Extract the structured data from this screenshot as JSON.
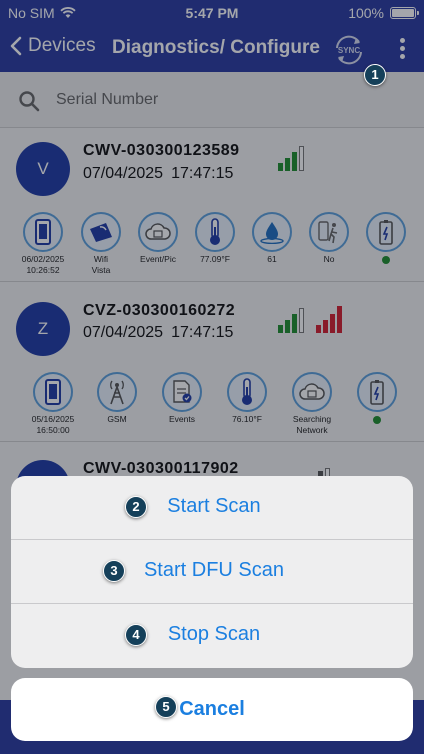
{
  "status_bar": {
    "carrier": "No SIM",
    "time": "5:47 PM",
    "battery": "100%"
  },
  "nav": {
    "back_label": "Devices",
    "title": "Diagnostics/ Configure",
    "sync_label": "SYNC"
  },
  "search": {
    "placeholder": "Serial Number"
  },
  "devices": [
    {
      "initial": "V",
      "serial": "CWV-030300123589",
      "date": "07/04/2025",
      "time": "17:47:15",
      "signal_bars": [
        {
          "level": 3,
          "color": "#1f8f2e"
        }
      ],
      "chips": [
        {
          "icon": "device-icon",
          "label": "06/02/2025\n10:26:52"
        },
        {
          "icon": "wifi-icon",
          "label": "Wifi\nVista"
        },
        {
          "icon": "cloud-image-icon",
          "label": "Event/Pic"
        },
        {
          "icon": "thermometer-icon",
          "label": "77.09°F"
        },
        {
          "icon": "water-drop-icon",
          "label": "61"
        },
        {
          "icon": "motion-icon",
          "label": "No"
        },
        {
          "icon": "battery-icon",
          "label": "",
          "dot": true
        }
      ]
    },
    {
      "initial": "Z",
      "serial": "CVZ-030300160272",
      "date": "07/04/2025",
      "time": "17:47:15",
      "signal_bars": [
        {
          "level": 3,
          "color": "#1f8f2e"
        },
        {
          "level": 4,
          "color": "#d32030"
        }
      ],
      "chips": [
        {
          "icon": "device-icon",
          "label": "05/16/2025\n16:50:00"
        },
        {
          "icon": "cell-tower-icon",
          "label": "GSM"
        },
        {
          "icon": "events-icon",
          "label": "Events"
        },
        {
          "icon": "thermometer-icon",
          "label": "76.10°F"
        },
        {
          "icon": "cloud-image-icon",
          "label": "Searching\nNetwork"
        },
        {
          "icon": "battery-icon",
          "label": "",
          "dot": true
        }
      ]
    },
    {
      "initial": "",
      "serial": "CWV-030300117902"
    }
  ],
  "action_sheet": {
    "options": [
      {
        "badge": "2",
        "label": "Start Scan"
      },
      {
        "badge": "3",
        "label": "Start DFU Scan"
      },
      {
        "badge": "4",
        "label": "Stop Scan"
      }
    ],
    "cancel": {
      "badge": "5",
      "label": "Cancel"
    }
  },
  "badges": {
    "sync": "1"
  },
  "colors": {
    "nav": "#2a3ba0",
    "accent": "#1b7fe0",
    "avatar": "#1f3ba5",
    "signal_good": "#1f8f2e",
    "signal_bad": "#d32030"
  }
}
